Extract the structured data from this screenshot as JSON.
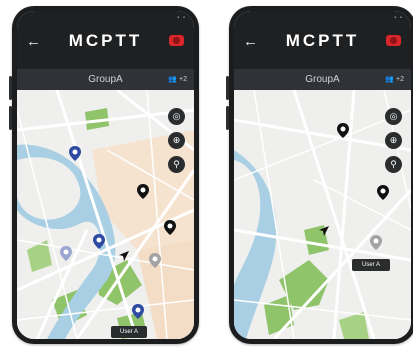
{
  "screens": [
    {
      "title": "MCPTT",
      "group": "GroupA",
      "members": "+2",
      "user_button": "User A"
    },
    {
      "title": "MCPTT",
      "group": "GroupA",
      "members": "+2",
      "user_button": "User A"
    }
  ],
  "icons": {
    "back": "arrow-left-icon",
    "record": "record-icon",
    "members": "group-icon",
    "locate": "locate-icon",
    "target": "crosshair-icon",
    "pin": "map-pin-icon",
    "navigation": "navigation-arrow-icon"
  },
  "colors": {
    "topbar": "#1e2022",
    "groupbar": "#2f3236",
    "record": "#d9262b",
    "water": "#a9cfe4",
    "park": "#8fc46b",
    "pin_blue": "#2f4aa3",
    "pin_black": "#111111"
  }
}
